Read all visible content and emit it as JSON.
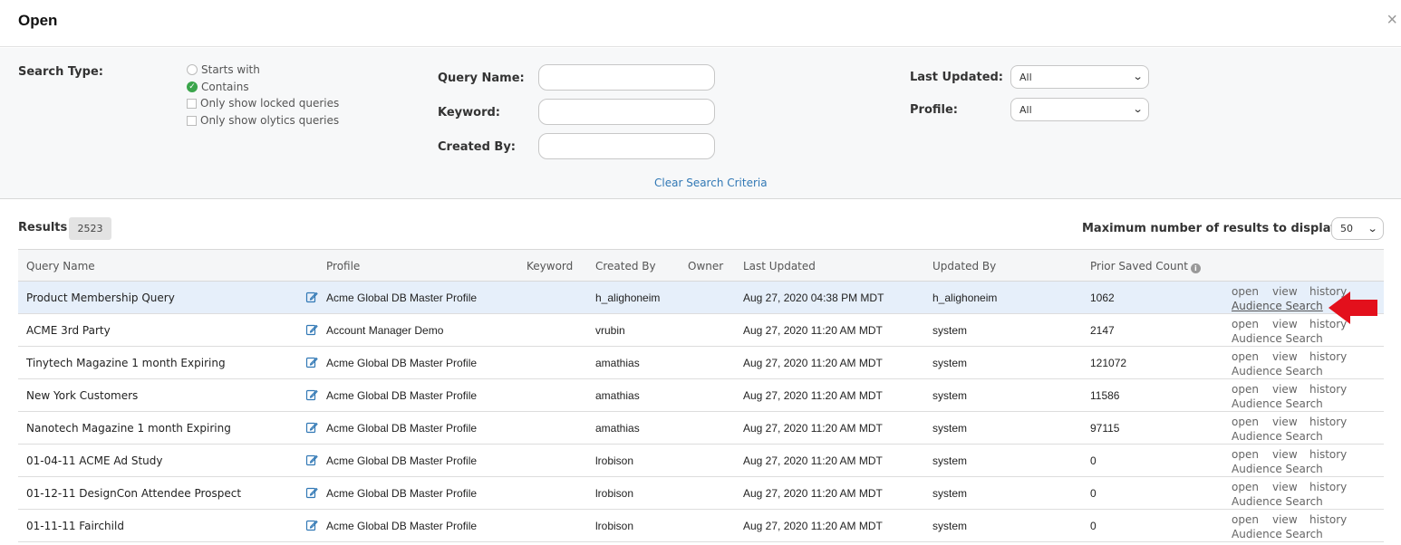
{
  "dialog": {
    "title": "Open",
    "close_label": "×"
  },
  "search": {
    "search_type_label": "Search Type:",
    "options": [
      {
        "label": "Starts with",
        "type": "radio",
        "checked": false
      },
      {
        "label": "Contains",
        "type": "radio",
        "checked": true
      },
      {
        "label": "Only show locked queries",
        "type": "checkbox",
        "checked": false
      },
      {
        "label": "Only show olytics queries",
        "type": "checkbox",
        "checked": false
      }
    ],
    "query_name_label": "Query Name:",
    "query_name_value": "",
    "keyword_label": "Keyword:",
    "keyword_value": "",
    "created_by_label": "Created By:",
    "created_by_value": "",
    "last_updated_label": "Last Updated:",
    "last_updated_value": "All",
    "profile_label": "Profile:",
    "profile_value": "All",
    "clear_label": "Clear Search Criteria"
  },
  "results": {
    "label": "Results",
    "count": "2523",
    "max_label": "Maximum number of results to display:",
    "max_value": "50"
  },
  "table": {
    "columns": {
      "query_name": "Query Name",
      "profile": "Profile",
      "keyword": "Keyword",
      "created_by": "Created By",
      "owner": "Owner",
      "last_updated": "Last Updated",
      "updated_by": "Updated By",
      "prior_saved_count": "Prior Saved Count"
    },
    "actions": {
      "open": "open",
      "view": "view",
      "history": "history",
      "audience": "Audience Search"
    },
    "rows": [
      {
        "name": "Product Membership Query",
        "profile": "Acme Global DB Master Profile",
        "keyword": "",
        "created_by": "h_alighoneim",
        "owner": "",
        "last_updated": "Aug 27, 2020 04:38 PM MDT",
        "updated_by": "h_alighoneim",
        "count": "1062"
      },
      {
        "name": "ACME 3rd Party",
        "profile": "Account Manager Demo",
        "keyword": "",
        "created_by": "vrubin",
        "owner": "",
        "last_updated": "Aug 27, 2020 11:20 AM MDT",
        "updated_by": "system",
        "count": "2147"
      },
      {
        "name": "Tinytech Magazine 1 month Expiring",
        "profile": "Acme Global DB Master Profile",
        "keyword": "",
        "created_by": "amathias",
        "owner": "",
        "last_updated": "Aug 27, 2020 11:20 AM MDT",
        "updated_by": "system",
        "count": "121072"
      },
      {
        "name": "New York Customers",
        "profile": "Acme Global DB Master Profile",
        "keyword": "",
        "created_by": "amathias",
        "owner": "",
        "last_updated": "Aug 27, 2020 11:20 AM MDT",
        "updated_by": "system",
        "count": "11586"
      },
      {
        "name": "Nanotech Magazine 1 month Expiring",
        "profile": "Acme Global DB Master Profile",
        "keyword": "",
        "created_by": "amathias",
        "owner": "",
        "last_updated": "Aug 27, 2020 11:20 AM MDT",
        "updated_by": "system",
        "count": "97115"
      },
      {
        "name": "01-04-11 ACME Ad Study",
        "profile": "Acme Global DB Master Profile",
        "keyword": "",
        "created_by": "lrobison",
        "owner": "",
        "last_updated": "Aug 27, 2020 11:20 AM MDT",
        "updated_by": "system",
        "count": "0"
      },
      {
        "name": "01-12-11 DesignCon Attendee Prospect",
        "profile": "Acme Global DB Master Profile",
        "keyword": "",
        "created_by": "lrobison",
        "owner": "",
        "last_updated": "Aug 27, 2020 11:20 AM MDT",
        "updated_by": "system",
        "count": "0"
      },
      {
        "name": "01-11-11 Fairchild",
        "profile": "Acme Global DB Master Profile",
        "keyword": "",
        "created_by": "lrobison",
        "owner": "",
        "last_updated": "Aug 27, 2020 11:20 AM MDT",
        "updated_by": "system",
        "count": "0"
      }
    ]
  },
  "colors": {
    "accent": "#3178b5",
    "selected_row": "#e6effa",
    "arrow": "#e3101c",
    "check": "#3aa54b"
  }
}
